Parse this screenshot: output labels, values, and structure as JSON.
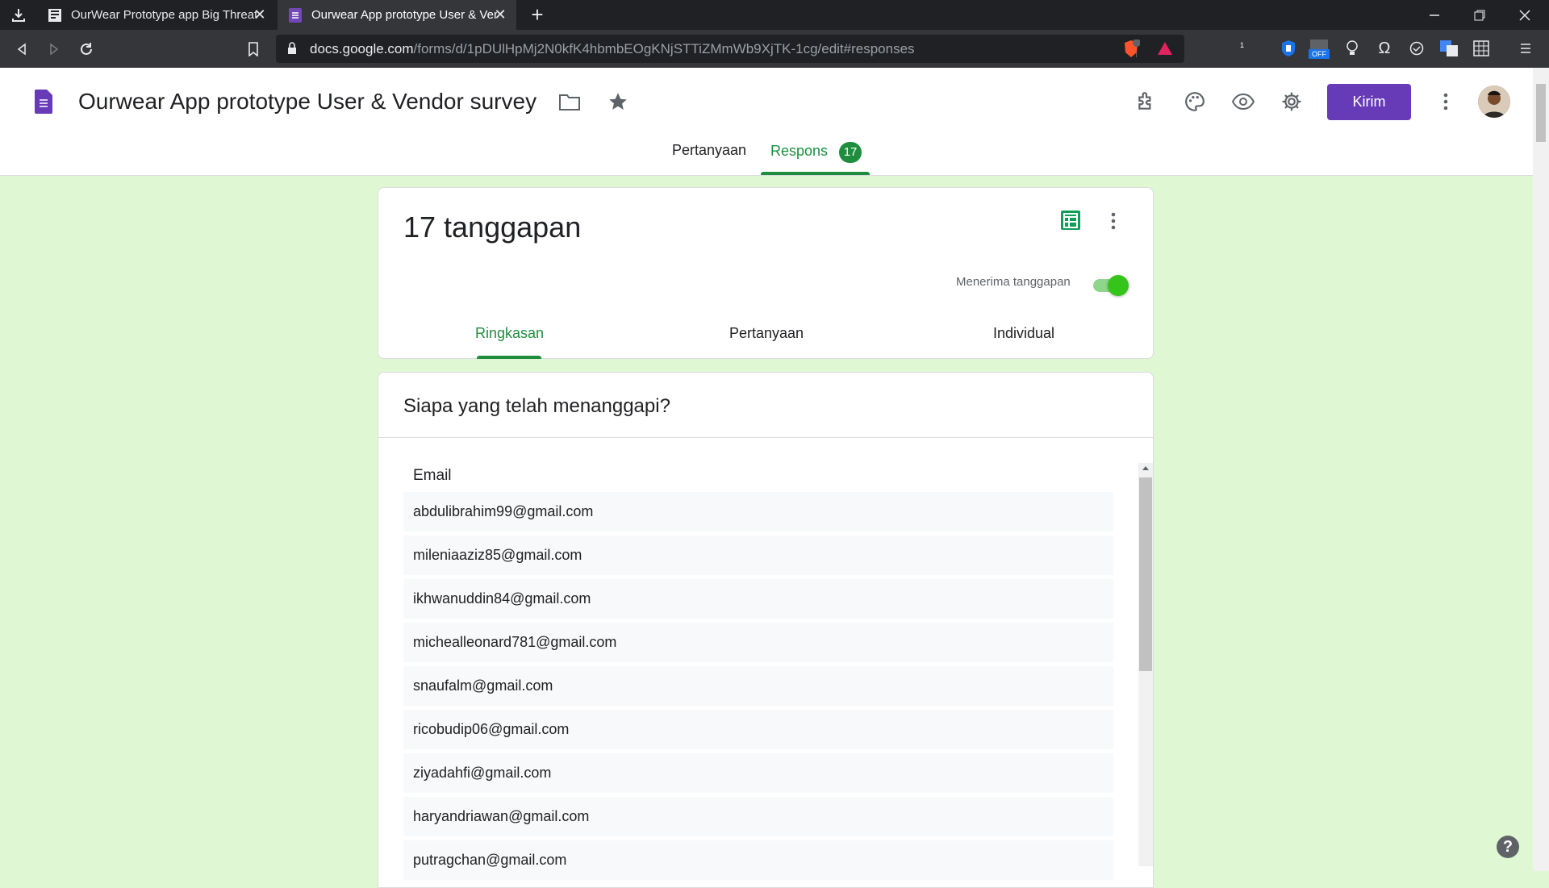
{
  "browser": {
    "tabs": [
      {
        "title": "OurWear Prototype app Big Threat",
        "active": false
      },
      {
        "title": "Ourwear App prototype User & Vendor survey",
        "active": true
      }
    ],
    "url_host": "docs.google.com",
    "url_path": "/forms/d/1pDUlHpMj2N0kfK4hbmbEOgKNjSTTiZMmWb9XjTK-1cg/edit#responses",
    "shield_badge": "1",
    "ext_off_label": "OFF"
  },
  "form": {
    "title": "Ourwear App prototype User & Vendor survey",
    "send_label": "Kirim",
    "tabs": {
      "questions": "Pertanyaan",
      "responses": "Respons",
      "responses_count": "17"
    }
  },
  "summary_card": {
    "count_label": "17 tanggapan",
    "accepting_label": "Menerima tanggapan",
    "accepting": true,
    "subtabs": {
      "summary": "Ringkasan",
      "question": "Pertanyaan",
      "individual": "Individual"
    }
  },
  "who_card": {
    "title": "Siapa yang telah menanggapi?",
    "column_header": "Email",
    "emails": [
      "abdulibrahim99@gmail.com",
      "mileniaaziz85@gmail.com",
      "ikhwanuddin84@gmail.com",
      "michealleonard781@gmail.com",
      "snaufalm@gmail.com",
      "ricobudip06@gmail.com",
      "ziyadahfi@gmail.com",
      "haryandriawan@gmail.com",
      "putragchan@gmail.com"
    ]
  },
  "help_label": "?",
  "colors": {
    "accent_green": "#1e8e3e",
    "send_purple": "#673ab7",
    "page_bg": "#e0f7d4"
  }
}
